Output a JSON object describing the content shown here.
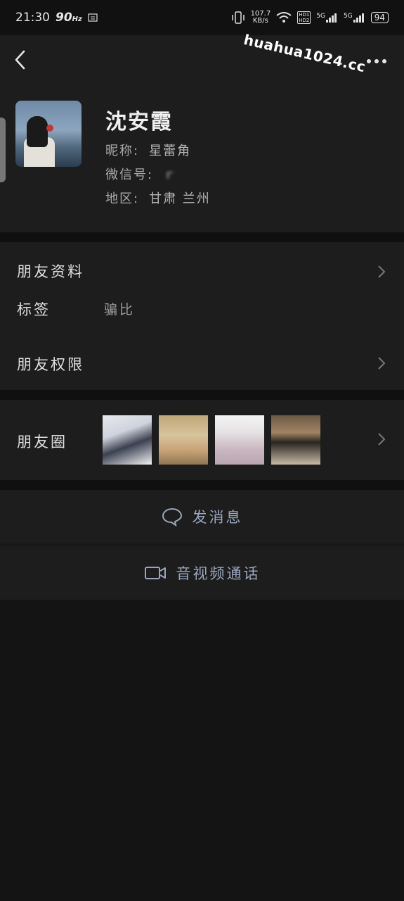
{
  "status_bar": {
    "time": "21:30",
    "refresh_rate": "90",
    "refresh_unit": "Hz",
    "net_speed": "107.7",
    "net_unit": "KB/s",
    "hd_label_1": "HD1",
    "hd_label_2": "HD2",
    "sig1_label": "5G",
    "sig2_label": "5G",
    "battery": "94"
  },
  "watermark": "huahua1024.cc",
  "profile": {
    "name": "沈安霞",
    "nickname_label": "昵称:",
    "nickname": "星蕾角",
    "wechat_id_label": "微信号:",
    "wechat_id": "ｒ",
    "region_label": "地区:",
    "region": "甘肃  兰州"
  },
  "rows": {
    "friend_info_label": "朋友资料",
    "tag_label": "标签",
    "tag_value": "骗比",
    "permissions_label": "朋友权限",
    "moments_label": "朋友圈"
  },
  "actions": {
    "message_label": "发消息",
    "call_label": "音视频通话"
  },
  "colors": {
    "background": "#141414",
    "card": "#1d1d1d",
    "action_text": "#9aa5bd"
  }
}
